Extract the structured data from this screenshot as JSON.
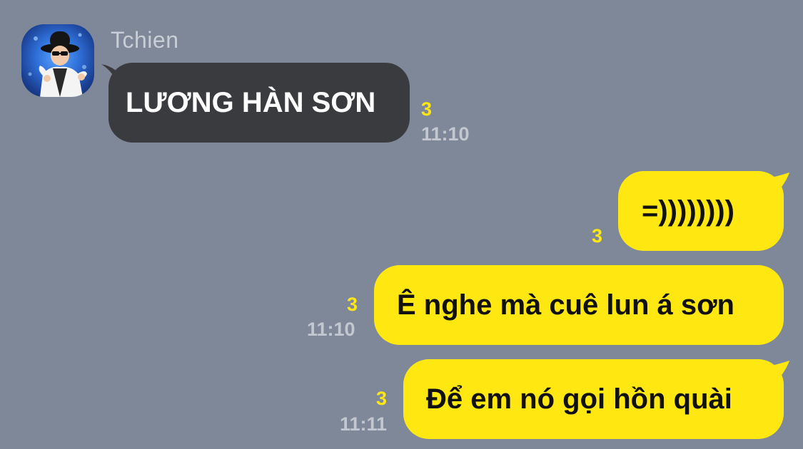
{
  "conversation": {
    "incoming": {
      "sender": "Tchien",
      "text": "LƯƠNG HÀN SƠN",
      "unread": "3",
      "time": "11:10"
    },
    "outgoing": [
      {
        "text": "=))))))))",
        "unread": "3",
        "time": ""
      },
      {
        "text": "Ê nghe mà cuê lun á sơn",
        "unread": "3",
        "time": "11:10"
      },
      {
        "text": "Để em nó gọi hồn quài",
        "unread": "3",
        "time": "11:11"
      }
    ]
  },
  "colors": {
    "background": "#7f8898",
    "incoming_bubble": "#3a3b3f",
    "outgoing_bubble": "#ffe812",
    "unread_count": "#ffe812",
    "timestamp": "#c3c7cf"
  },
  "icons": {
    "avatar": "profile-photo"
  }
}
